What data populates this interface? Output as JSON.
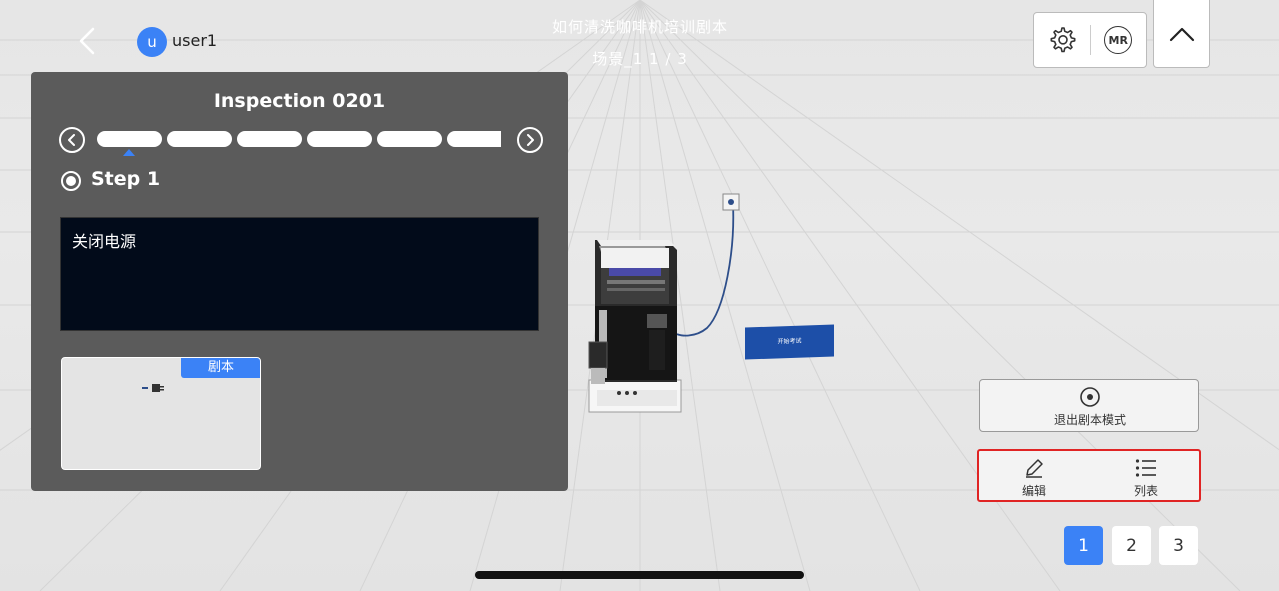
{
  "header": {
    "user_initial": "u",
    "username": "user1",
    "title": "如何清洗咖啡机培训剧本",
    "subtitle": "场景_1 1 / 3",
    "mr_label": "MR"
  },
  "panel": {
    "title": "Inspection 0201",
    "step_label": "Step 1",
    "description": "关闭电源",
    "thumbnail_tag": "剧本",
    "step_segments": 6
  },
  "controls": {
    "exit_label": "退出剧本模式",
    "edit_label": "编辑",
    "list_label": "列表"
  },
  "pagination": {
    "pages": [
      "1",
      "2",
      "3"
    ],
    "active": "1"
  },
  "scene": {
    "sign_text": "开始考试"
  },
  "colors": {
    "accent": "#3b82f6",
    "highlight_border": "#e02424",
    "panel_bg": "#5b5b5b",
    "desc_bg": "#020b1a"
  }
}
